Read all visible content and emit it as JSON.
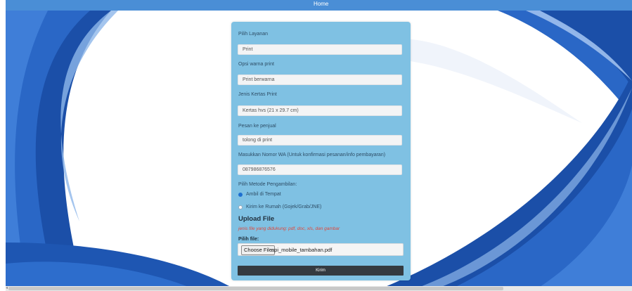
{
  "nav": {
    "home_label": "Home"
  },
  "form": {
    "service": {
      "label": "Pilih Layanan",
      "value": "Print"
    },
    "color_option": {
      "label": "Opsi warna print",
      "value": "Print berwarna"
    },
    "paper": {
      "label": "Jenis Kertas Print",
      "value": "Kertas hvs (21 x 29.7 cm)"
    },
    "message": {
      "label": "Pesan ke penjual",
      "value": "tolong di print"
    },
    "wa": {
      "label": "Masukkan Nomor WA (Untuk konfirmasi pesanan/info pembayaran)",
      "value": "087986876576"
    },
    "pickup": {
      "label": "Pilih Metode Pengambilan:",
      "options": [
        {
          "label": "Ambil di Tempat",
          "checked": true
        },
        {
          "label": "Kirim ke Rumah (Gojek/Grab/JNE)",
          "checked": false
        }
      ]
    },
    "upload": {
      "title": "Upload File",
      "note": "jenis file yang didukung: pdf, doc, xls, dan gambar",
      "file_label": "Pilih file:",
      "choose_button": "Choose File",
      "file_name": "api_mobile_tambahan.pdf"
    },
    "submit_label": "Kirim"
  },
  "colors": {
    "nav": "#4a8ed6",
    "card": "#7fc1e3",
    "submit": "#343a40",
    "note": "#e0463a",
    "radio_checked": "#1e6fd0"
  }
}
